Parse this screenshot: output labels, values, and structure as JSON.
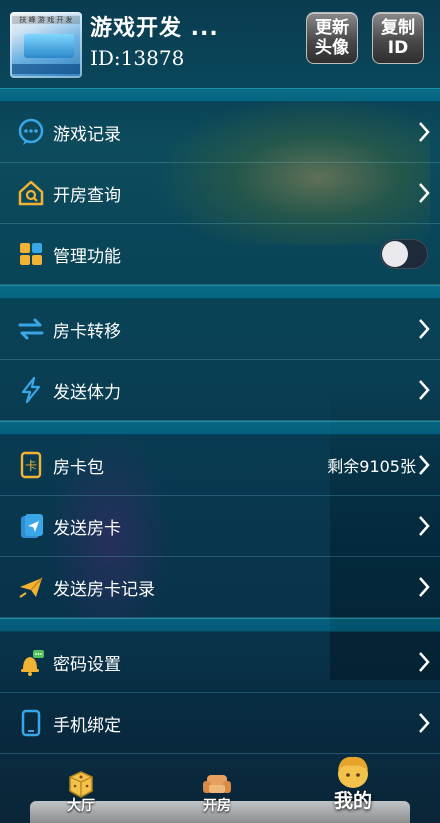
{
  "header": {
    "user_name": "游戏开发 ...",
    "user_id": "ID:13878",
    "avatar_banner": "扶 峰 游 戏 开 发",
    "update_avatar_label": "更新头像",
    "copy_id_label": "复制ID"
  },
  "menu": {
    "game_records": "游戏记录",
    "room_query": "开房查询",
    "management": "管理功能",
    "card_transfer": "房卡转移",
    "send_stamina": "发送体力",
    "card_pack": "房卡包",
    "card_pack_remaining": "剩余9105张",
    "send_card": "发送房卡",
    "send_card_records": "发送房卡记录",
    "password_settings": "密码设置",
    "phone_binding": "手机绑定"
  },
  "management_toggle_on": false,
  "nav": {
    "lobby": "大厅",
    "create_room": "开房",
    "mine": "我的"
  },
  "colors": {
    "accent_orange": "#f2b233",
    "accent_blue": "#3aa6e8",
    "toggle_off": "#1d2a3a"
  }
}
